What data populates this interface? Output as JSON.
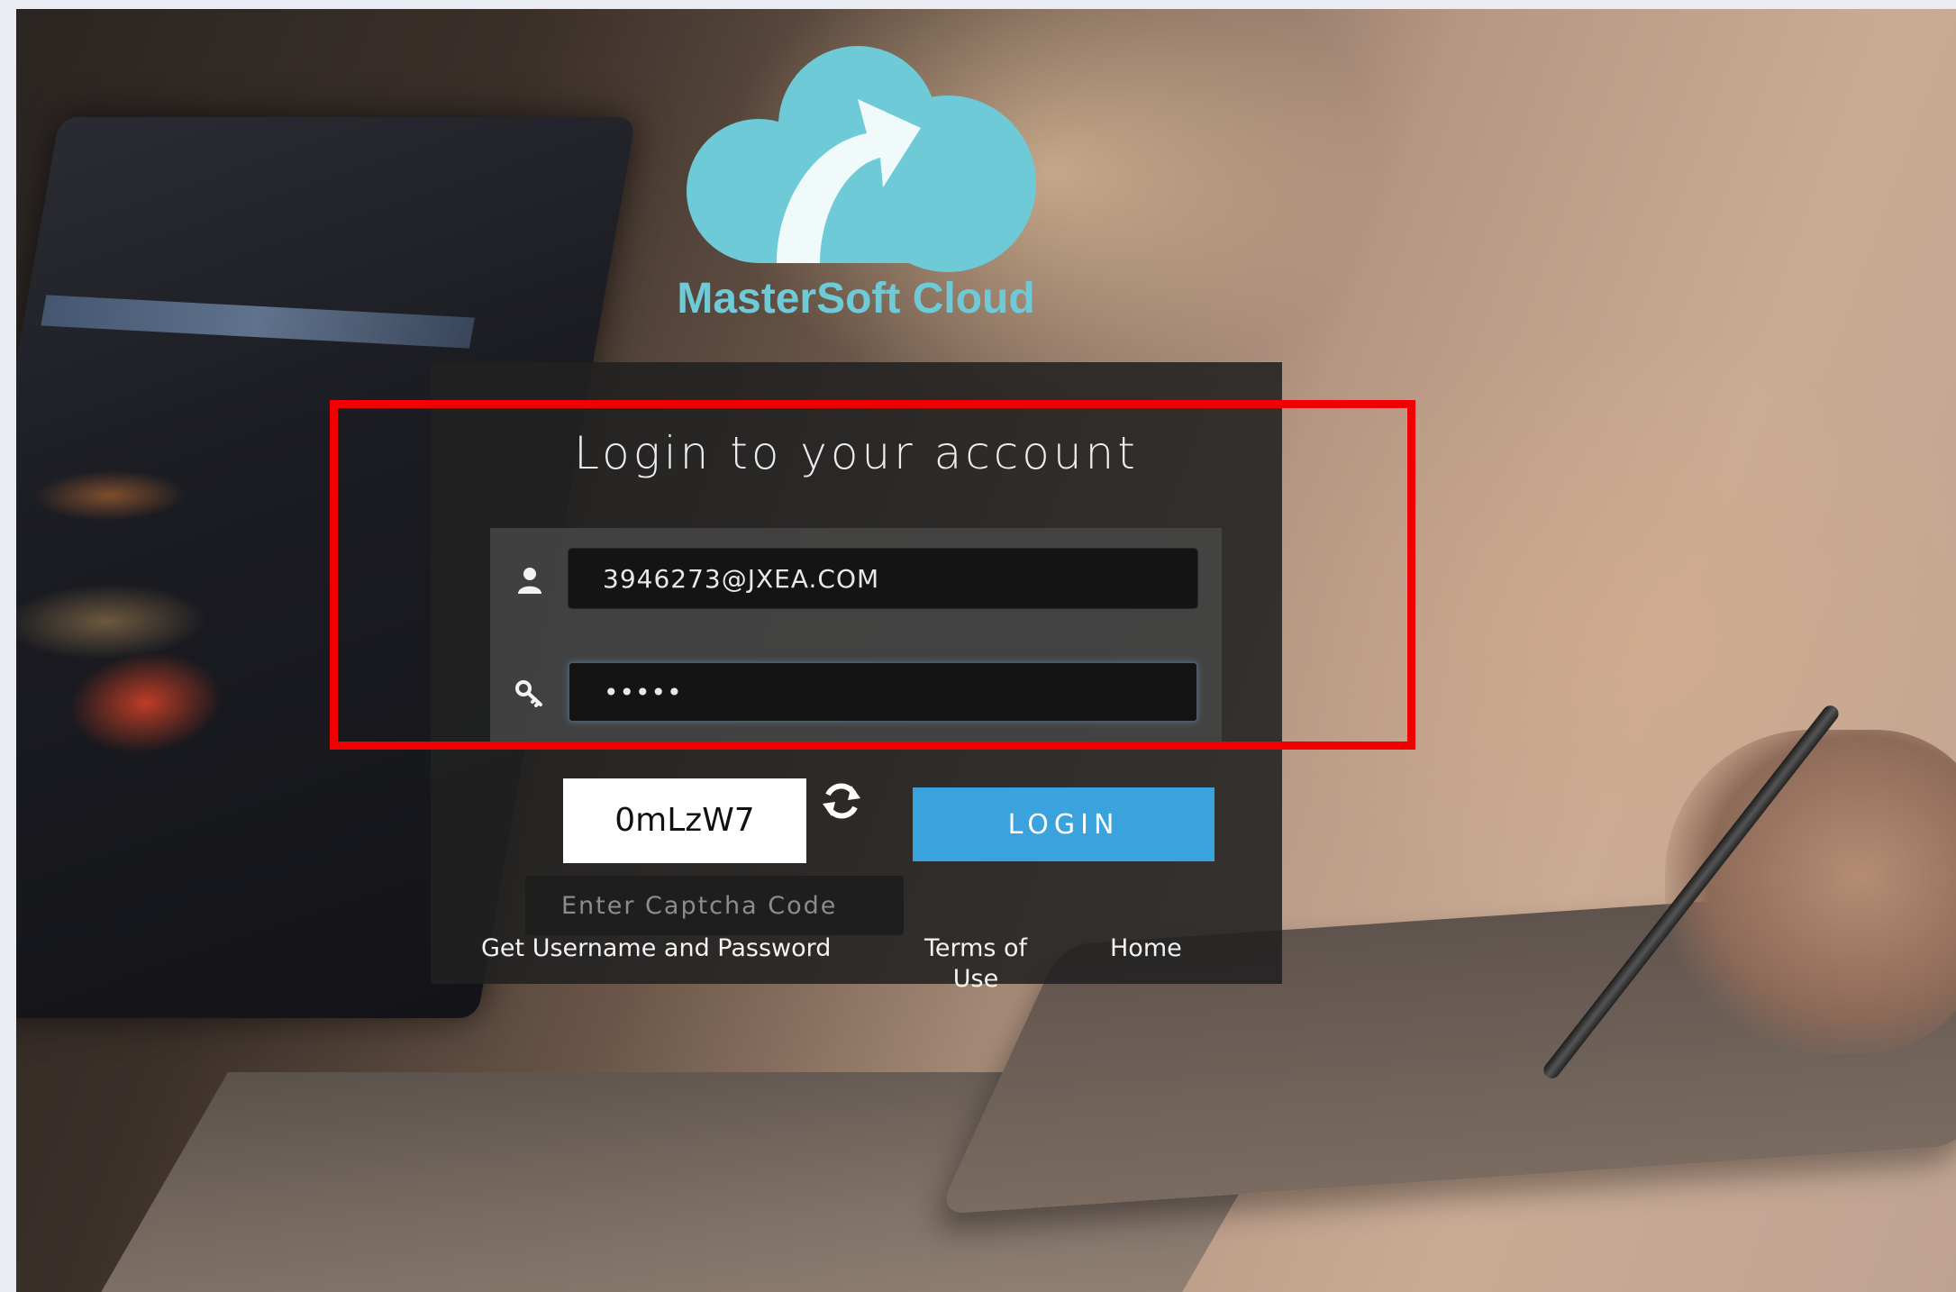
{
  "logo": {
    "name": "MasterSoft Cloud",
    "color": "#6fcad8"
  },
  "login": {
    "title": "Login to your account",
    "username": {
      "icon": "user-icon",
      "value": "3946273@JXEA.COM"
    },
    "password": {
      "icon": "key-icon",
      "value": "•••••"
    },
    "captcha": {
      "code": "0mLzW7",
      "refresh_icon": "refresh-icon",
      "placeholder": "Enter Captcha Code"
    },
    "button_label": "LOGIN",
    "button_color": "#3aa3dd"
  },
  "links": {
    "get_credentials": "Get Username and Password",
    "terms": "Terms of Use",
    "home": "Home"
  },
  "annotation": {
    "highlight_color": "#f00000"
  }
}
